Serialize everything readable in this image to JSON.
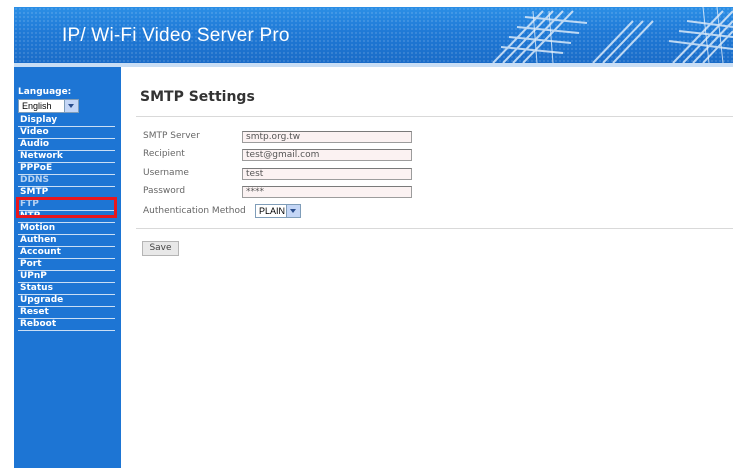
{
  "header": {
    "title": "IP/ Wi-Fi Video Server Pro"
  },
  "sidebar": {
    "language_label": "Language:",
    "language_value": "English",
    "items": [
      {
        "label": "Display"
      },
      {
        "label": "Video"
      },
      {
        "label": "Audio"
      },
      {
        "label": "Network"
      },
      {
        "label": "PPPoE"
      },
      {
        "label": "DDNS"
      },
      {
        "label": "SMTP"
      },
      {
        "label": "FTP"
      },
      {
        "label": "NTP"
      },
      {
        "label": "Motion"
      },
      {
        "label": "Authen"
      },
      {
        "label": "Account"
      },
      {
        "label": "Port"
      },
      {
        "label": "UPnP"
      },
      {
        "label": "Status"
      },
      {
        "label": "Upgrade"
      },
      {
        "label": "Reset"
      },
      {
        "label": "Reboot"
      }
    ]
  },
  "main": {
    "title": "SMTP Settings",
    "fields": {
      "smtp_server": {
        "label": "SMTP Server",
        "value": "smtp.org.tw"
      },
      "recipient": {
        "label": "Recipient",
        "value": "test@gmail.com"
      },
      "username": {
        "label": "Username",
        "value": "test"
      },
      "password": {
        "label": "Password",
        "value": "****"
      },
      "auth_method": {
        "label": "Authentication Method",
        "value": "PLAIN"
      }
    },
    "save_label": "Save"
  },
  "colors": {
    "header_blue": "#1f79d6",
    "sidebar_blue": "#1d75d4",
    "highlight_red": "#e8161d"
  }
}
